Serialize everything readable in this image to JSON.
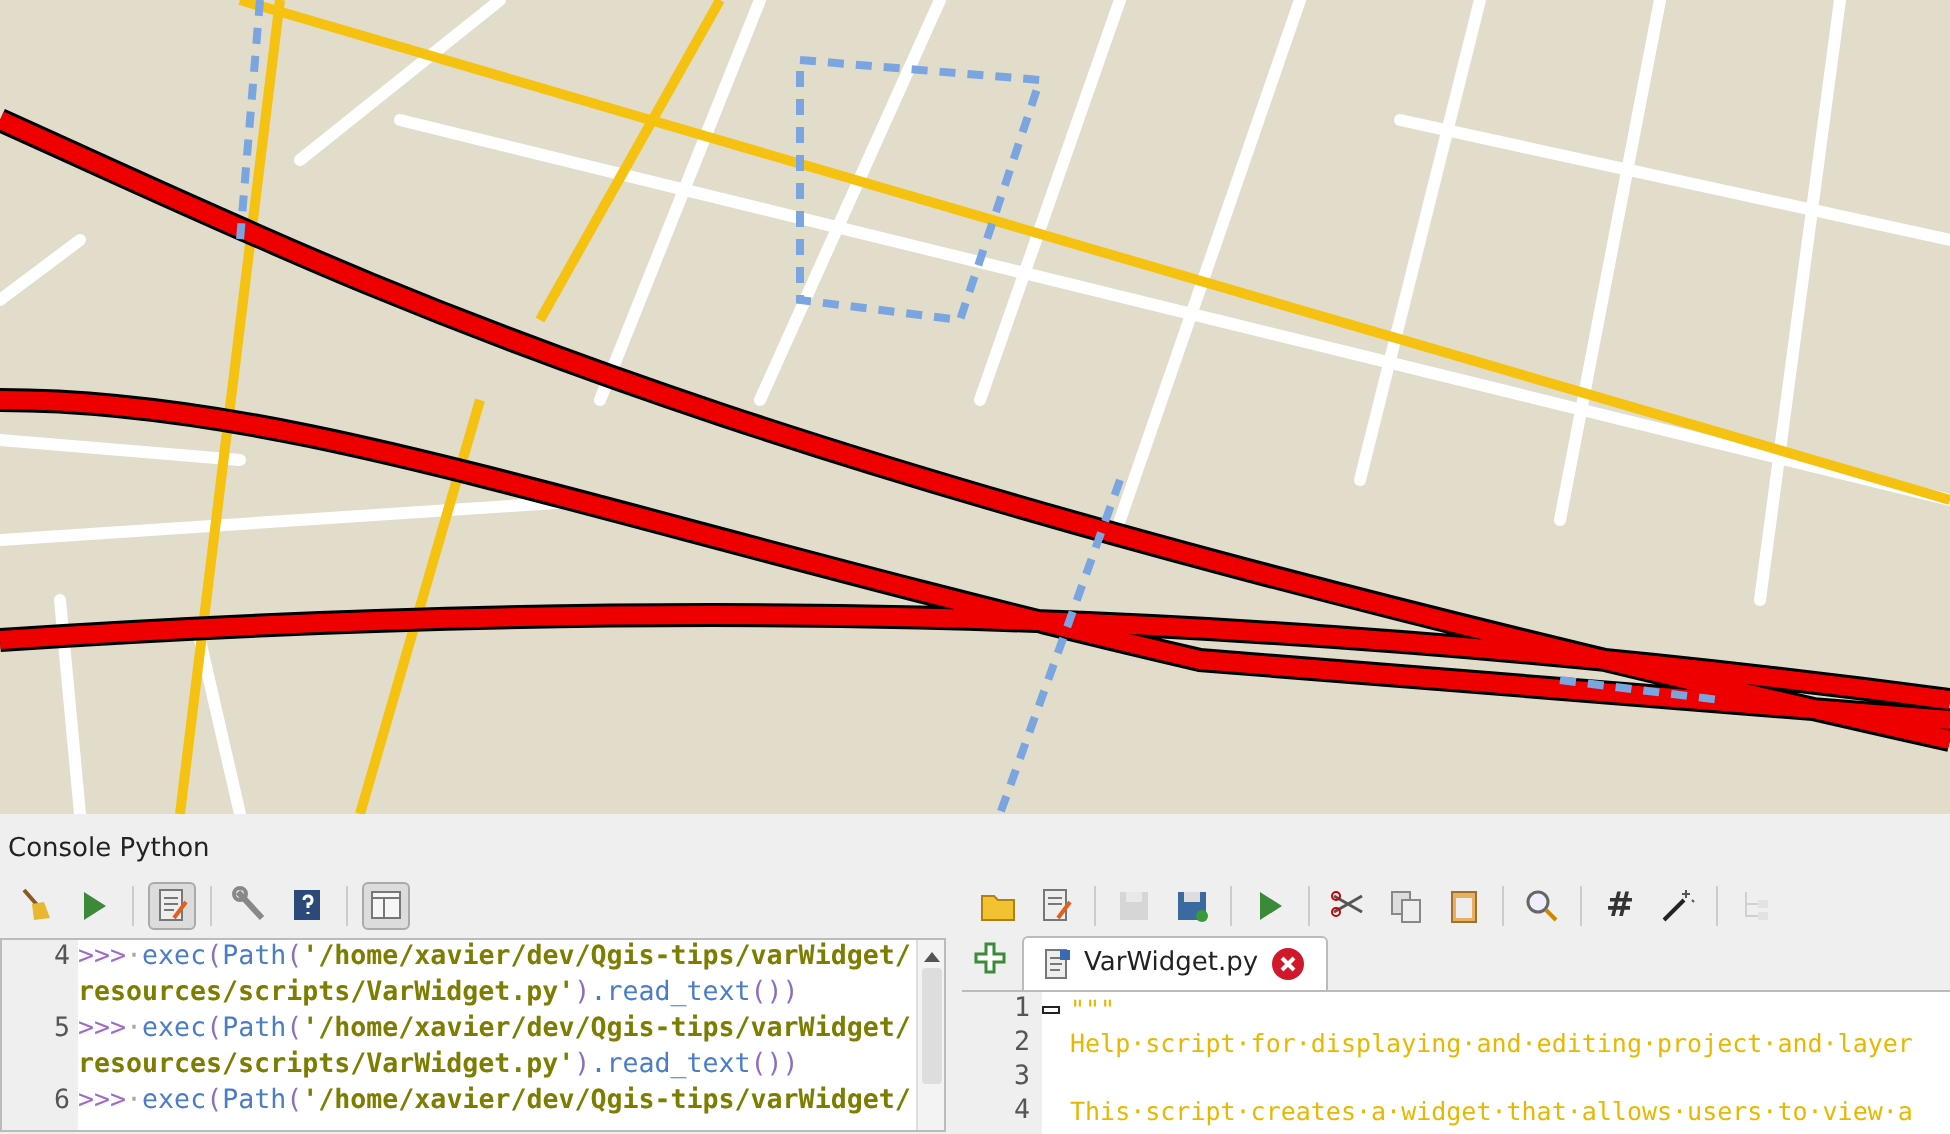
{
  "console": {
    "title": "Console Python",
    "toolbar": [
      {
        "kind": "broom"
      },
      {
        "kind": "run"
      },
      {
        "kind": "sep"
      },
      {
        "kind": "editor",
        "checked": true
      },
      {
        "kind": "sep"
      },
      {
        "kind": "wrench"
      },
      {
        "kind": "help"
      },
      {
        "kind": "sep"
      },
      {
        "kind": "panel",
        "checked": true
      }
    ],
    "lines": [
      {
        "number": "4",
        "tokens": [
          {
            "kind": "prompt",
            "text": ">>>"
          },
          {
            "kind": "space",
            "text": "·"
          },
          {
            "kind": "name",
            "text": "exec"
          },
          {
            "kind": "punct",
            "text": "("
          },
          {
            "kind": "name",
            "text": "Path"
          },
          {
            "kind": "punct",
            "text": "("
          },
          {
            "kind": "string",
            "text": "'/home/xavier/dev/Qgis-tips/varWidget/"
          }
        ]
      },
      {
        "tokens": [
          {
            "kind": "string",
            "text": "resources/scripts/VarWidget.py'"
          },
          {
            "kind": "punct",
            "text": ")"
          },
          {
            "kind": "name",
            "text": ".read_text"
          },
          {
            "kind": "punct",
            "text": "())"
          }
        ]
      },
      {
        "number": "5",
        "tokens": [
          {
            "kind": "prompt",
            "text": ">>>"
          },
          {
            "kind": "space",
            "text": "·"
          },
          {
            "kind": "name",
            "text": "exec"
          },
          {
            "kind": "punct",
            "text": "("
          },
          {
            "kind": "name",
            "text": "Path"
          },
          {
            "kind": "punct",
            "text": "("
          },
          {
            "kind": "string",
            "text": "'/home/xavier/dev/Qgis-tips/varWidget/"
          }
        ]
      },
      {
        "tokens": [
          {
            "kind": "string",
            "text": "resources/scripts/VarWidget.py'"
          },
          {
            "kind": "punct",
            "text": ")"
          },
          {
            "kind": "name",
            "text": ".read_text"
          },
          {
            "kind": "punct",
            "text": "())"
          }
        ]
      },
      {
        "number": "6",
        "tokens": [
          {
            "kind": "prompt",
            "text": ">>>"
          },
          {
            "kind": "space",
            "text": "·"
          },
          {
            "kind": "name",
            "text": "exec"
          },
          {
            "kind": "punct",
            "text": "("
          },
          {
            "kind": "name",
            "text": "Path"
          },
          {
            "kind": "punct",
            "text": "("
          },
          {
            "kind": "string",
            "text": "'/home/xavier/dev/Qgis-tips/varWidget/"
          }
        ]
      }
    ]
  },
  "editor": {
    "toolbar": [
      {
        "kind": "folder",
        "disabled": false
      },
      {
        "kind": "edit",
        "disabled": false
      },
      {
        "kind": "sep"
      },
      {
        "kind": "save",
        "disabled": true
      },
      {
        "kind": "saveas",
        "disabled": false
      },
      {
        "kind": "sep"
      },
      {
        "kind": "run",
        "disabled": false
      },
      {
        "kind": "sep"
      },
      {
        "kind": "cut",
        "disabled": false
      },
      {
        "kind": "copy",
        "disabled": false
      },
      {
        "kind": "paste",
        "disabled": false
      },
      {
        "kind": "sep"
      },
      {
        "kind": "find",
        "disabled": false
      },
      {
        "kind": "sep"
      },
      {
        "kind": "hash",
        "text": "#",
        "disabled": false
      },
      {
        "kind": "wand",
        "disabled": false
      },
      {
        "kind": "sep"
      },
      {
        "kind": "tree",
        "disabled": true
      }
    ],
    "tabs": [
      {
        "label": "VarWidget.py",
        "selected": true
      }
    ],
    "lines": [
      {
        "number": "1",
        "text": "\"\"\"",
        "folded": false
      },
      {
        "number": "2",
        "text": "Help·script·for·displaying·and·editing·project·and·layer"
      },
      {
        "number": "3"
      },
      {
        "number": "4",
        "text": "This·script·creates·a·widget·that·allows·users·to·view·a"
      }
    ]
  }
}
